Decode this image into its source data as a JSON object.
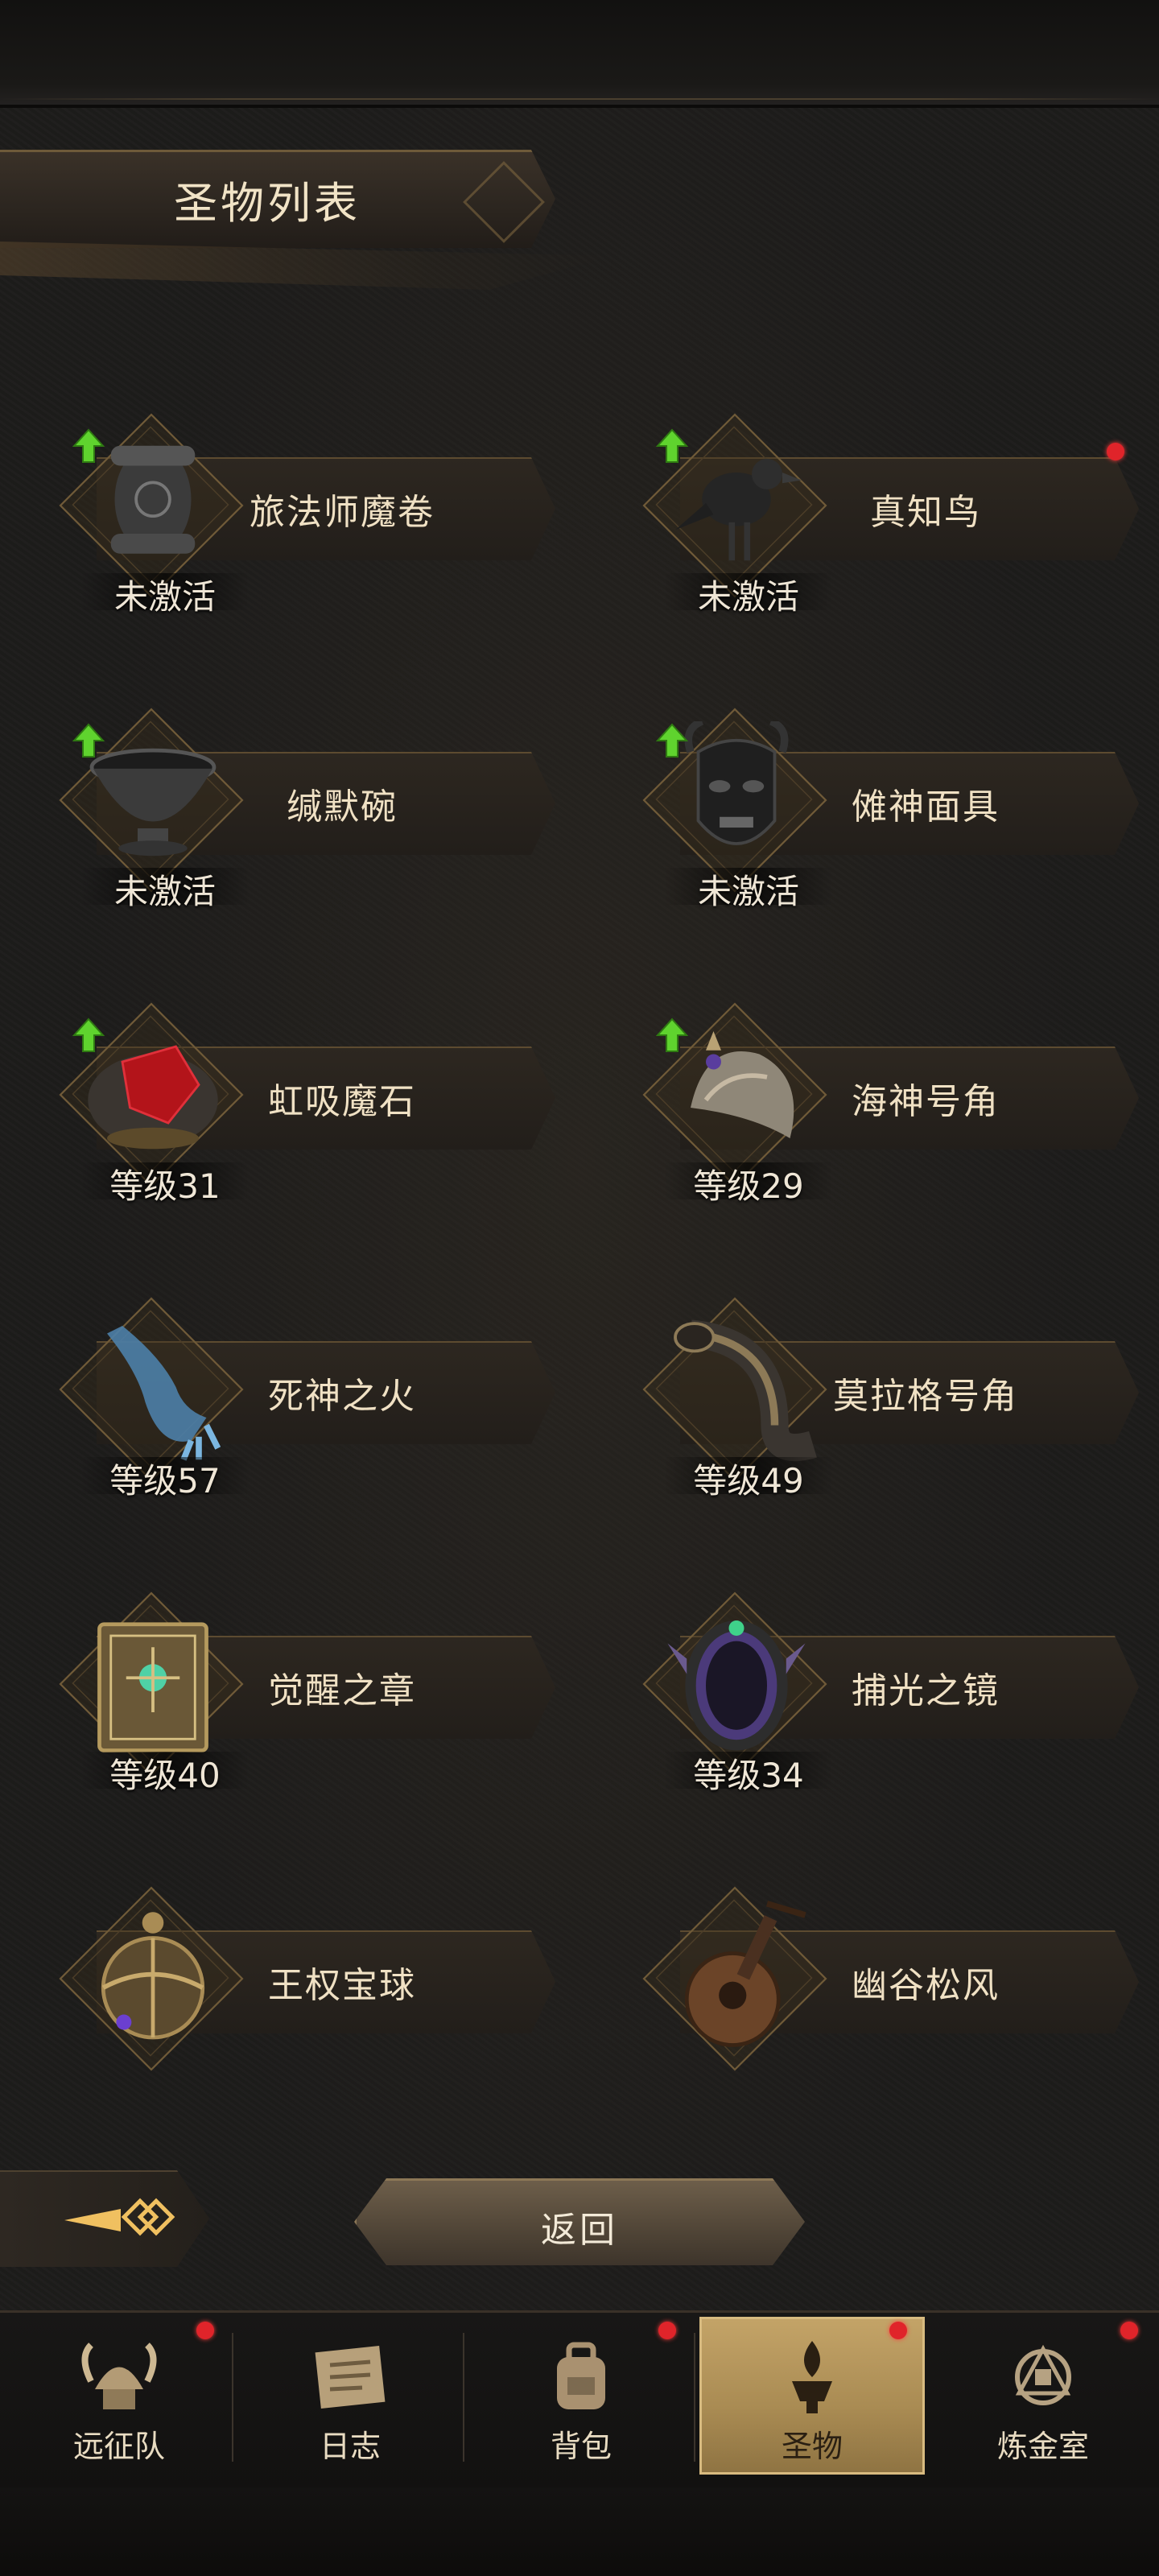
{
  "header": {
    "title": "圣物列表"
  },
  "relics": [
    {
      "name": "旅法师魔卷",
      "status": "未激活",
      "upgrade": true,
      "dot": false,
      "icon": "scroll-icon"
    },
    {
      "name": "真知鸟",
      "status": "未激活",
      "upgrade": true,
      "dot": true,
      "icon": "crow-statue-icon"
    },
    {
      "name": "缄默碗",
      "status": "未激活",
      "upgrade": true,
      "dot": false,
      "icon": "bowl-icon"
    },
    {
      "name": "傩神面具",
      "status": "未激活",
      "upgrade": true,
      "dot": false,
      "icon": "demon-mask-icon"
    },
    {
      "name": "虹吸魔石",
      "status": "等级31",
      "upgrade": true,
      "dot": false,
      "icon": "red-gem-icon"
    },
    {
      "name": "海神号角",
      "status": "等级29",
      "upgrade": true,
      "dot": false,
      "icon": "conch-icon"
    },
    {
      "name": "死神之火",
      "status": "等级57",
      "upgrade": false,
      "dot": false,
      "icon": "spectral-hand-icon"
    },
    {
      "name": "莫拉格号角",
      "status": "等级49",
      "upgrade": false,
      "dot": false,
      "icon": "horn-icon"
    },
    {
      "name": "觉醒之章",
      "status": "等级40",
      "upgrade": false,
      "dot": false,
      "icon": "tome-icon"
    },
    {
      "name": "捕光之镜",
      "status": "等级34",
      "upgrade": false,
      "dot": false,
      "icon": "mirror-icon"
    },
    {
      "name": "王权宝球",
      "status": "",
      "upgrade": false,
      "dot": false,
      "icon": "orb-icon"
    },
    {
      "name": "幽谷松风",
      "status": "",
      "upgrade": false,
      "dot": false,
      "icon": "lute-icon"
    }
  ],
  "actions": {
    "return_label": "返回"
  },
  "nav": [
    {
      "label": "远征队",
      "icon": "viking-helmet-icon",
      "dot": true,
      "active": false
    },
    {
      "label": "日志",
      "icon": "journal-icon",
      "dot": false,
      "active": false
    },
    {
      "label": "背包",
      "icon": "backpack-icon",
      "dot": true,
      "active": false
    },
    {
      "label": "圣物",
      "icon": "brazier-icon",
      "dot": true,
      "active": true
    },
    {
      "label": "炼金室",
      "icon": "alchemy-icon",
      "dot": true,
      "active": false
    }
  ],
  "colors": {
    "accent": "#c4a468",
    "notify": "#e0242a",
    "upgrade": "#5fd32e"
  }
}
